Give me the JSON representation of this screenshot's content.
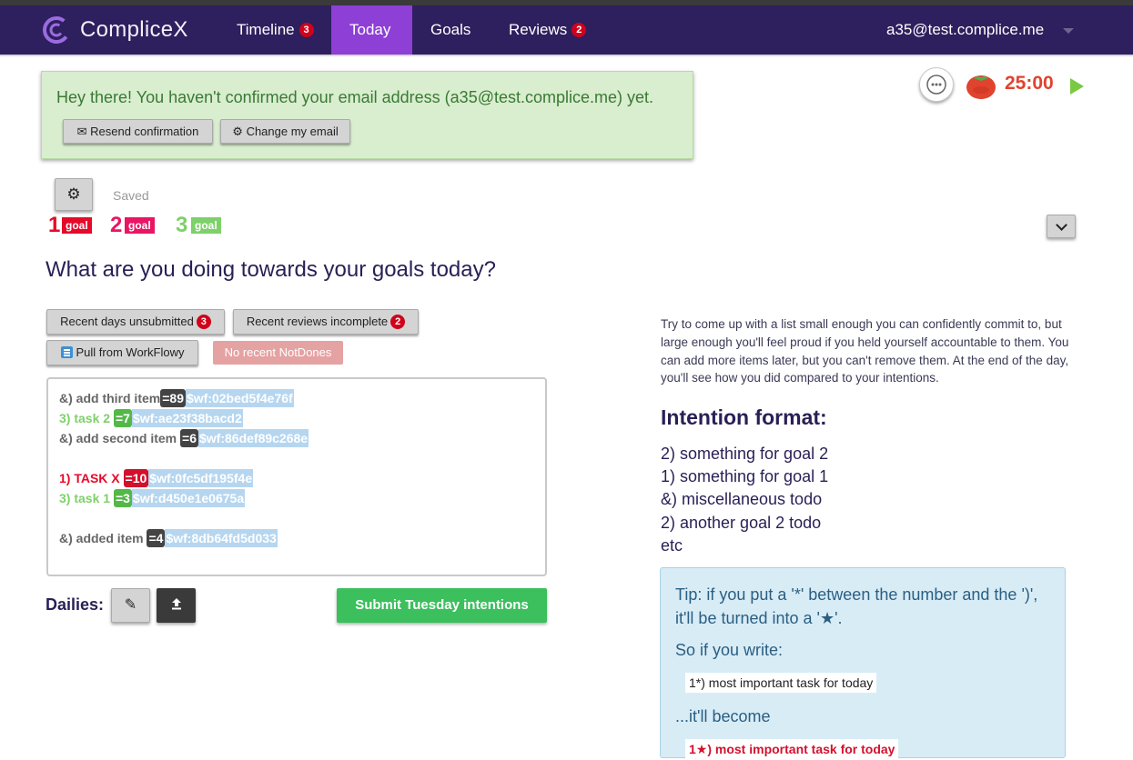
{
  "nav": {
    "brand": "CompliceX",
    "tabs": [
      {
        "label": "Timeline",
        "badge": "3"
      },
      {
        "label": "Today",
        "badge": ""
      },
      {
        "label": "Goals",
        "badge": ""
      },
      {
        "label": "Reviews",
        "badge": "2"
      }
    ],
    "user": "a35@test.complice.me"
  },
  "alert": {
    "text": "Hey there! You haven't confirmed your email address (a35@test.complice.me) yet.",
    "resend_label": "Resend confirmation",
    "change_label": "Change my email"
  },
  "pomodoro": {
    "time": "25:00"
  },
  "settings": {
    "saved_label": "Saved"
  },
  "goals": [
    {
      "num": "1",
      "tag": "goal 1",
      "color": "#e6092a"
    },
    {
      "num": "2",
      "tag": "goal 2",
      "color": "#ea1564"
    },
    {
      "num": "3",
      "tag": "goal 3",
      "color": "#7ed06a"
    }
  ],
  "question": "What are you doing towards your goals today?",
  "buttons": {
    "recent_days": "Recent days unsubmitted",
    "recent_days_badge": "3",
    "recent_reviews": "Recent reviews incomplete",
    "recent_reviews_badge": "2",
    "workflowy": "Pull from WorkFlowy",
    "notdones": "No recent NotDones"
  },
  "intentions": [
    {
      "text": "&) add third item",
      "pill": "=89",
      "pill_style": "dark",
      "wf": "$wf:02bed5f4e76f",
      "color": "#666666"
    },
    {
      "text": "3) task 2",
      "pill": "=7",
      "pill_style": "green",
      "wf": "$wf:ae23f38bacd2",
      "color": "#7ed06a"
    },
    {
      "text": "&) add second item",
      "pill": "=6",
      "pill_style": "dark",
      "wf": "$wf:86def89c268e",
      "color": "#666666"
    },
    {
      "text": "1) TASK X",
      "pill": "=10",
      "pill_style": "red",
      "wf": "$wf:0fc5df195f4e",
      "color": "#e6092a"
    },
    {
      "text": "3) task 1",
      "pill": "=3",
      "pill_style": "green",
      "wf": "$wf:d450e1e0675a",
      "color": "#7ed06a"
    },
    {
      "text": "&) added item ",
      "pill": "=4",
      "pill_style": "dark",
      "wf": "$wf:8db64fd5d033",
      "color": "#666666"
    }
  ],
  "dailies_label": "Dailies:",
  "submit_label": "Submit Tuesday intentions",
  "help": {
    "text": "Try to come up with a list small enough you can confidently commit to, but large enough you'll feel proud if you held yourself accountable to them. You can add more items later, but you can't remove them. At the end of the day, you'll see how you did compared to your intentions.",
    "format_title": "Intention format:",
    "format_lines": [
      "2) something for goal 2",
      "1) something for goal 1",
      "&) miscellaneous todo",
      "2) another goal 2 todo",
      "etc"
    ]
  },
  "tip": {
    "line1": "Tip: if you put a '*' between the number and the ')', it'll be turned into a '★'.",
    "line2": "So if you write:",
    "code1": "1*) most important task for today",
    "line3": "...it'll become",
    "code2": "1★) most important task for today"
  }
}
